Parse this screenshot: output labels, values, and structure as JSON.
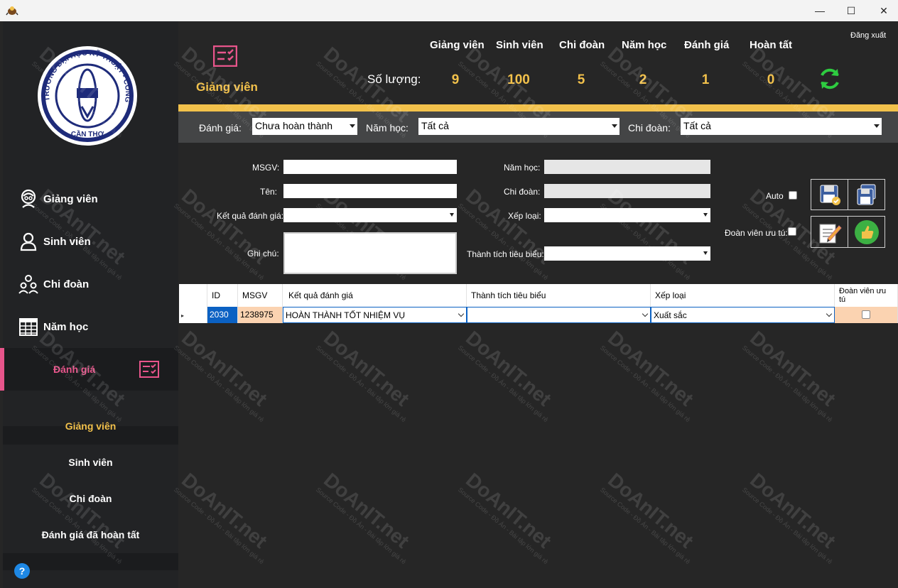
{
  "window": {
    "minimize_glyph": "—",
    "maximize_glyph": "☐",
    "close_glyph": "✕"
  },
  "sidebar": {
    "logo": {
      "ring_text": "TRƯỜNG ĐẠI HỌC KỸ THUẬT - CÔNG NGHỆ",
      "bottom_text": "CẦN THƠ"
    },
    "nav": [
      {
        "label": "Giảng viên",
        "icon": "lecturer-icon"
      },
      {
        "label": "Sinh viên",
        "icon": "student-icon"
      },
      {
        "label": "Chi đoàn",
        "icon": "group-icon"
      },
      {
        "label": "Năm học",
        "icon": "calendar-grid-icon"
      },
      {
        "label": "Đánh giá",
        "icon": "checklist-icon"
      }
    ],
    "sub_items": [
      "Giảng viên",
      "Sinh viên",
      "Chi đoàn",
      "Đánh giá đã hoàn tất"
    ],
    "help": "?",
    "colors": {
      "active_bar": "#e8558b",
      "sub_active": "#f2c14b"
    }
  },
  "header": {
    "section_title": "Giảng viên",
    "logout": "Đăng xuất",
    "count_label": "Số lượng:",
    "stats": [
      {
        "label": "Giảng viên",
        "value": "9"
      },
      {
        "label": "Sinh viên",
        "value": "100"
      },
      {
        "label": "Chi đoàn",
        "value": "5"
      },
      {
        "label": "Năm học",
        "value": "2"
      },
      {
        "label": "Đánh giá",
        "value": "1"
      },
      {
        "label": "Hoàn tất",
        "value": "0"
      }
    ],
    "accent": "#f2c14b"
  },
  "filters": {
    "danh_gia_label": "Đánh giá:",
    "danh_gia_value": "Chưa hoàn thành",
    "nam_hoc_label": "Năm học:",
    "nam_hoc_value": "Tất cả",
    "chi_doan_label": "Chi đoàn:",
    "chi_doan_value": "Tất cả"
  },
  "form": {
    "msgv_label": "MSGV:",
    "ten_label": "Tên:",
    "ket_qua_label": "Kết quả đánh giá:",
    "ghi_chu_label": "Ghi chú:",
    "nam_hoc_label": "Năm học:",
    "chi_doan_label": "Chi đoàn:",
    "xep_loai_label": "Xếp loại:",
    "thanh_tich_label": "Thành tích tiêu biểu:",
    "auto_label": "Auto",
    "doan_vien_label": "Đoàn viên ưu tú:"
  },
  "grid": {
    "columns": [
      "ID",
      "MSGV",
      "Kết quả đánh giá",
      "Thành tích tiêu biểu",
      "Xếp loại",
      "Đoàn viên ưu tú"
    ],
    "rows": [
      {
        "id": "2030",
        "msgv": "1238975",
        "ket_qua": "HOÀN THÀNH TỐT NHIỆM VỤ",
        "thanh_tich": "",
        "xep_loai": "Xuất sắc"
      }
    ]
  },
  "watermark": {
    "brand": "DoAnIT.net",
    "tagline": "Source Code - Đồ Án - Bài tập lớn giá rẻ"
  }
}
